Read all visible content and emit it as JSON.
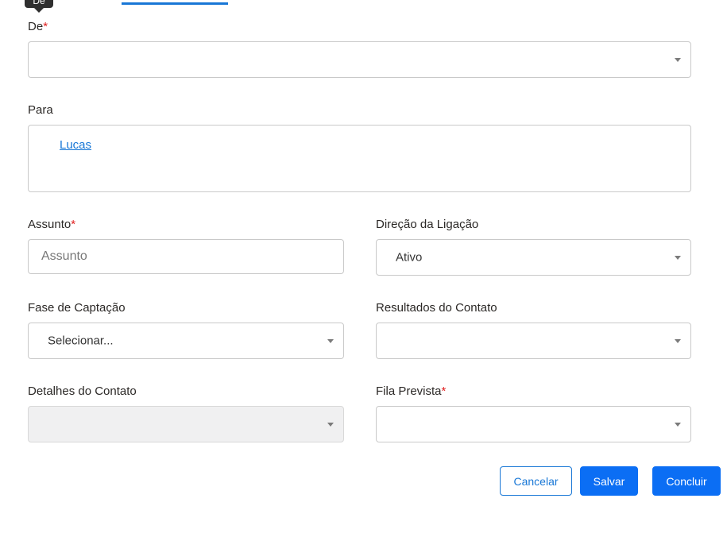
{
  "tooltip": {
    "text": "De"
  },
  "form": {
    "de": {
      "label": "De",
      "required_mark": "*",
      "value": ""
    },
    "para": {
      "label": "Para",
      "recipients": [
        "Lucas"
      ]
    },
    "assunto": {
      "label": "Assunto",
      "required_mark": "*",
      "placeholder": "Assunto",
      "value": ""
    },
    "direcao": {
      "label": "Direção da Ligação",
      "value": "Ativo"
    },
    "fase": {
      "label": "Fase de Captação",
      "value": "Selecionar..."
    },
    "resultados": {
      "label": "Resultados do Contato",
      "value": ""
    },
    "detalhes": {
      "label": "Detalhes do Contato",
      "value": "",
      "disabled": true
    },
    "fila": {
      "label": "Fila Prevista",
      "required_mark": "*",
      "value": ""
    }
  },
  "actions": {
    "cancel_label": "Cancelar",
    "save_label": "Salvar",
    "finish_label": "Concluir"
  },
  "colors": {
    "accent": "#0b6ef4",
    "link": "#1877d6",
    "required": "#e02020"
  }
}
